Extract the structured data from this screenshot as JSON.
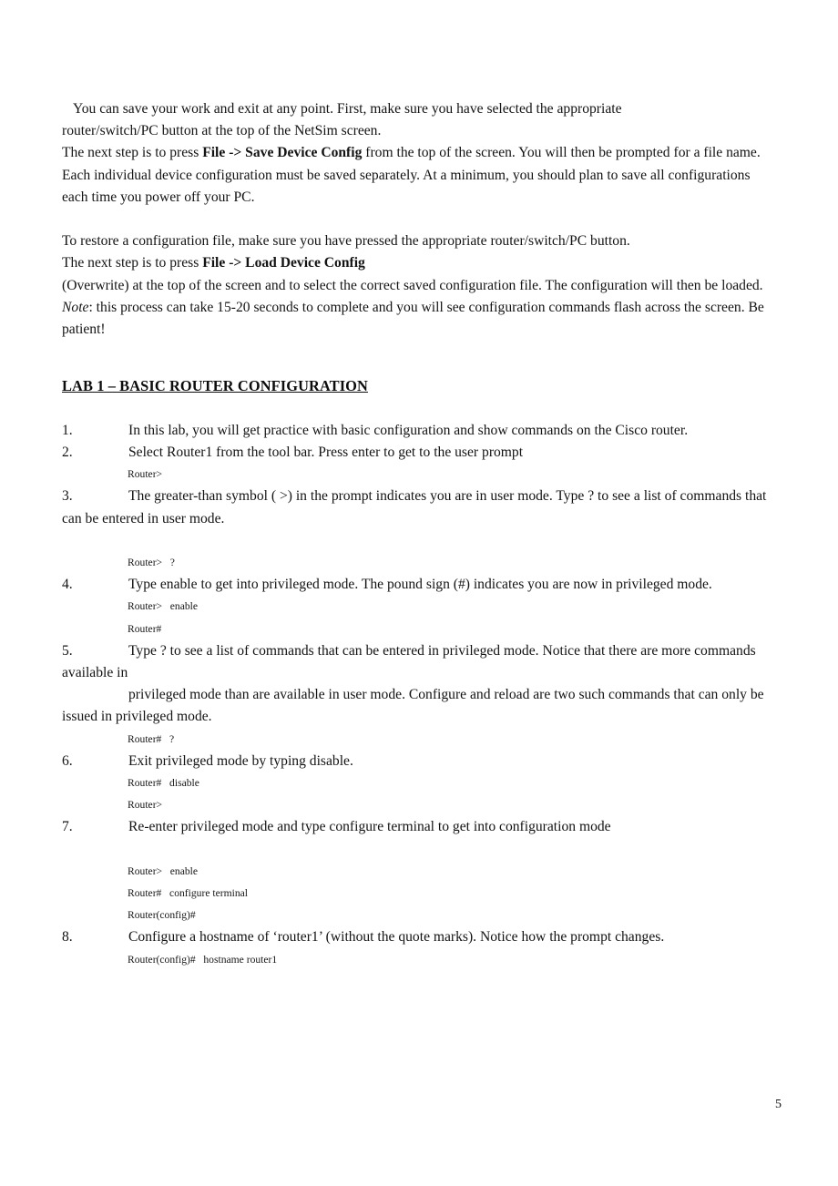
{
  "document": {
    "page_number": "5",
    "intro_blocks": [
      {
        "id": "save-work-paragraph",
        "lines": [
          "You can save your work and exit at any point.    First, make sure you have selected the appropriate",
          "router/switch/PC button at the top of the NetSim screen."
        ]
      }
    ],
    "save_paragraph": {
      "before_bold": "The next step is to press ",
      "bold": "File -> Save Device Config",
      "after_bold": " from the top of the screen. You will then be prompted for a file name."
    },
    "each_device_paragraph": "Each individual device configuration must be saved separately.    At a minimum, you should plan to save all configurations each time you power off your PC.",
    "restore_paragraph": "To restore a configuration file, make sure you have pressed the appropriate router/switch/PC button.",
    "load_paragraph": {
      "before_bold": "The next step is to press  ",
      "bold": "File -> Load Device Config",
      "after_bold": ""
    },
    "overwrite_paragraph": "(Overwrite) at the top of the screen    and to select the correct saved configuration file.    The configuration will then be loaded.",
    "note_paragraph": {
      "italic_label": "Note",
      "rest": ": this process can take 15-20 seconds to complete and you will see configuration commands flash across the screen.    Be patient!"
    },
    "lab_heading": "LAB 1 – BASIC ROUTER CONFIGURATION",
    "steps": [
      {
        "number": "1.",
        "text": "In this lab, you will get practice with basic configuration and show commands on the Cisco router.",
        "cli": []
      },
      {
        "number": "2.",
        "text": "Select Router1 from the tool bar.    Press enter to get to the user prompt",
        "cli": [
          "Router>"
        ]
      },
      {
        "number": "3.",
        "text": "The greater-than symbol ( >) in the prompt indicates you are in user mode.    Type ? to see a list of commands that can be entered in user mode.",
        "cli_blank_before": true,
        "cli": [
          "Router>   ?"
        ]
      },
      {
        "number": "4.",
        "text": "Type enable to get into privileged mode.    The pound sign (#) indicates you are now in privileged mode.",
        "cli": [
          "Router>   enable",
          "Router#"
        ]
      },
      {
        "number": "5.",
        "text": "Type ? to see a list of commands that can be entered in privileged mode.    Notice that there are more commands available in",
        "continuation": "privileged mode than are available in user mode.    Configure and reload are two such commands that can only be issued in privileged mode.",
        "cli": [
          "Router#   ?"
        ]
      },
      {
        "number": "6.",
        "text": "Exit privileged mode by typing disable.",
        "cli": [
          "Router#   disable",
          "Router>"
        ]
      },
      {
        "number": "7.",
        "text": "Re-enter privileged mode and type configure terminal to get into configuration mode",
        "cli_blank_before": true,
        "cli": [
          "Router>   enable",
          "Router#   configure terminal",
          "Router(config)#"
        ]
      },
      {
        "number": "8.",
        "text": "Configure a hostname of   ‘router1’ (without the quote marks).    Notice how the prompt changes.",
        "cli": [
          "Router(config)#   hostname router1"
        ]
      }
    ]
  }
}
